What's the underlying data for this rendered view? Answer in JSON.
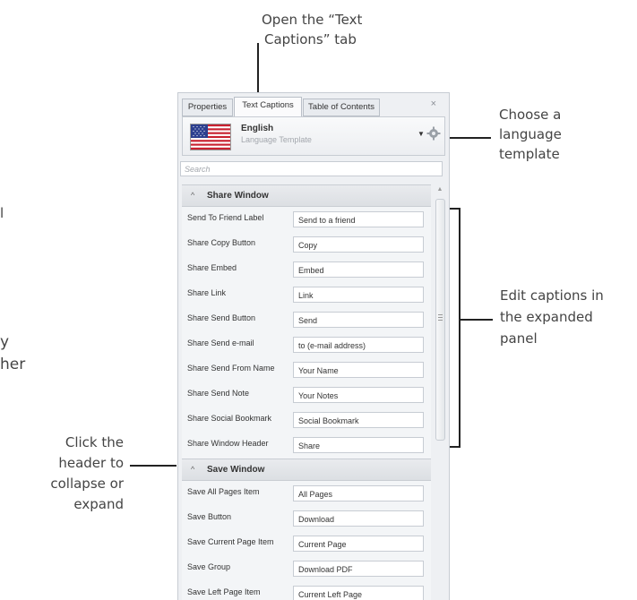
{
  "callouts": {
    "top": "Open the “Text Captions” tab",
    "top_line1": "Open the “Text",
    "top_line2": "Captions” tab",
    "right_template_1": "Choose a",
    "right_template_2": "language",
    "right_template_3": "template",
    "right_edit_1": "Edit captions in",
    "right_edit_2": "the expanded",
    "right_edit_3": "panel",
    "left_1": "Click the",
    "left_2": "header to",
    "left_3": "collapse or",
    "left_4": "expand"
  },
  "clipped_left_text": [
    "l",
    "y",
    "her"
  ],
  "tabs": [
    "Properties",
    "Text Captions",
    "Table of Contents"
  ],
  "active_tab": "Text Captions",
  "close_label": "×",
  "language": {
    "name": "English",
    "subtitle": "Language Template",
    "flag_icon": "us-flag-icon",
    "settings_icon": "gear-icon"
  },
  "search": {
    "placeholder": "Search"
  },
  "sections": [
    {
      "title": "Share Window",
      "rows": [
        {
          "label": "Send To Friend Label",
          "value": "Send to a friend"
        },
        {
          "label": "Share Copy Button",
          "value": "Copy"
        },
        {
          "label": "Share Embed",
          "value": "Embed"
        },
        {
          "label": "Share Link",
          "value": "Link"
        },
        {
          "label": "Share Send Button",
          "value": "Send"
        },
        {
          "label": "Share Send e-mail",
          "value": "to (e-mail address)"
        },
        {
          "label": "Share Send From Name",
          "value": "Your Name"
        },
        {
          "label": "Share Send Note",
          "value": "Your Notes"
        },
        {
          "label": "Share Social Bookmark",
          "value": "Social Bookmark"
        },
        {
          "label": "Share Window Header",
          "value": "Share"
        }
      ]
    },
    {
      "title": "Save Window",
      "rows": [
        {
          "label": "Save All Pages Item",
          "value": "All Pages"
        },
        {
          "label": "Save Button",
          "value": "Download"
        },
        {
          "label": "Save Current Page Item",
          "value": "Current Page"
        },
        {
          "label": "Save Group",
          "value": "Download PDF"
        },
        {
          "label": "Save Left Page Item",
          "value": "Current Left Page"
        }
      ]
    }
  ],
  "colors": {
    "panel_bg": "#eef0f3",
    "section_header": "#dcdfe3",
    "callout_text": "#444444"
  }
}
